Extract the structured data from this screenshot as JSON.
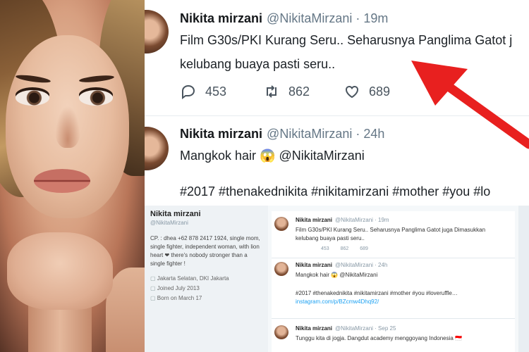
{
  "colors": {
    "arrow": "#e8201f",
    "handle_grey": "#657786",
    "link_blue": "#1da1f2",
    "text": "#14171a"
  },
  "tweets": [
    {
      "name": "Nikita mirzani",
      "handle": "@NikitaMirzani · 19m",
      "text_line1": "Film G30s/PKI Kurang Seru.. Seharusnya Panglima Gatot j",
      "text_line2": "kelubang buaya pasti seru..",
      "reply_count": "453",
      "retweet_count": "862",
      "like_count": "689",
      "icons": [
        "reply-icon",
        "retweet-icon",
        "like-icon"
      ]
    },
    {
      "name": "Nikita mirzani",
      "handle": "@NikitaMirzani · 24h",
      "text_line1": "Mangkok hair 😱 @NikitaMirzani",
      "hashtags": "#2017 #thenakednikita #nikitamirzani #mother #you #lo"
    }
  ],
  "embedded": {
    "profile_name": "Nikita mirzani",
    "profile_handle": "@NikitaMirzani",
    "profile_bio": "CP. : dhea +62 878 2417 1924, single mom, single fighter, independent woman, with lion heart ❤ there's nobody stronger than a single fighter !",
    "location": "Jakarta Selatan, DKI Jakarta",
    "joined": "Joined July 2013",
    "born": "Born on March 17",
    "mini_tweets": [
      {
        "name": "Nikita mirzani",
        "meta": "@NikitaMirzani · 19m",
        "line1": "Film G30s/PKI Kurang Seru.. Seharusnya Panglima Gatot juga Dimasukkan",
        "line2": "kelubang buaya pasti seru..",
        "actions": "453 862 689"
      },
      {
        "name": "Nikita mirzani",
        "meta": "@NikitaMirzani · 24h",
        "line1": "Mangkok hair 😱 @NikitaMirzani",
        "line2": "#2017 #thenakednikita #nikitamirzani #mother #you #loveruffle…",
        "line3": "instagram.com/p/BZcmw4Dhq92/"
      },
      {
        "name": "Nikita mirzani",
        "meta": "@NikitaMirzani · Sep 25",
        "line1": "Tunggu kita di jogja. Dangdut academy menggoyang Indonesia 🇮🇩"
      }
    ]
  }
}
